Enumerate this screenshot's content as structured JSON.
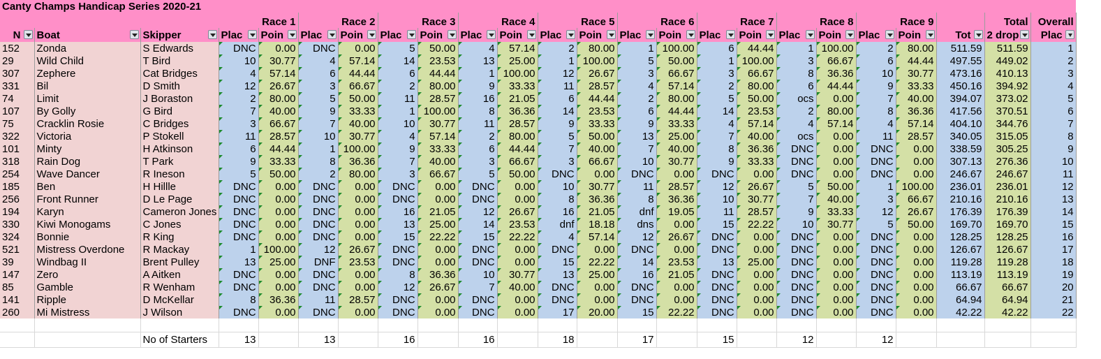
{
  "title": "Canty Champs Handicap Series 2020-21",
  "header": {
    "col_no": "N",
    "col_boat": "Boat",
    "col_skipper": "Skipper",
    "place_short": "Plac",
    "points_short": "Poin",
    "races": [
      "Race 1",
      "Race 2",
      "Race 3",
      "Race 4",
      "Race 5",
      "Race 6",
      "Race 7",
      "Race 8",
      "Race 9"
    ],
    "total_top": "Total",
    "total_label": "Tot",
    "total_drop": "2 drop",
    "overall_top": "Overall",
    "overall_label": "Plac"
  },
  "rows": [
    {
      "no": "152",
      "boat": "Zonda",
      "skipper": "S Edwards",
      "results": [
        [
          "DNC",
          "0.00"
        ],
        [
          "DNC",
          "0.00"
        ],
        [
          "5",
          "50.00"
        ],
        [
          "4",
          "57.14"
        ],
        [
          "2",
          "80.00"
        ],
        [
          "1",
          "100.00"
        ],
        [
          "6",
          "44.44"
        ],
        [
          "1",
          "100.00"
        ],
        [
          "2",
          "80.00"
        ]
      ],
      "total": "511.59",
      "total2": "511.59",
      "overall": "1"
    },
    {
      "no": "29",
      "boat": "Wild Child",
      "skipper": "T Bird",
      "results": [
        [
          "10",
          "30.77"
        ],
        [
          "4",
          "57.14"
        ],
        [
          "14",
          "23.53"
        ],
        [
          "13",
          "25.00"
        ],
        [
          "1",
          "100.00"
        ],
        [
          "5",
          "50.00"
        ],
        [
          "1",
          "100.00"
        ],
        [
          "3",
          "66.67"
        ],
        [
          "6",
          "44.44"
        ]
      ],
      "total": "497.55",
      "total2": "449.02",
      "overall": "2"
    },
    {
      "no": "307",
      "boat": "Zephere",
      "skipper": "Cat Bridges",
      "results": [
        [
          "4",
          "57.14"
        ],
        [
          "6",
          "44.44"
        ],
        [
          "6",
          "44.44"
        ],
        [
          "1",
          "100.00"
        ],
        [
          "12",
          "26.67"
        ],
        [
          "3",
          "66.67"
        ],
        [
          "3",
          "66.67"
        ],
        [
          "8",
          "36.36"
        ],
        [
          "10",
          "30.77"
        ]
      ],
      "total": "473.16",
      "total2": "410.13",
      "overall": "3"
    },
    {
      "no": "331",
      "boat": "Bil",
      "skipper": "D Smith",
      "results": [
        [
          "12",
          "26.67"
        ],
        [
          "3",
          "66.67"
        ],
        [
          "2",
          "80.00"
        ],
        [
          "9",
          "33.33"
        ],
        [
          "11",
          "28.57"
        ],
        [
          "4",
          "57.14"
        ],
        [
          "2",
          "80.00"
        ],
        [
          "6",
          "44.44"
        ],
        [
          "9",
          "33.33"
        ]
      ],
      "total": "450.16",
      "total2": "394.92",
      "overall": "4"
    },
    {
      "no": "74",
      "boat": "Limit",
      "skipper": "J Boraston",
      "results": [
        [
          "2",
          "80.00"
        ],
        [
          "5",
          "50.00"
        ],
        [
          "11",
          "28.57"
        ],
        [
          "16",
          "21.05"
        ],
        [
          "6",
          "44.44"
        ],
        [
          "2",
          "80.00"
        ],
        [
          "5",
          "50.00"
        ],
        [
          "ocs",
          "0.00"
        ],
        [
          "7",
          "40.00"
        ]
      ],
      "total": "394.07",
      "total2": "373.02",
      "overall": "5"
    },
    {
      "no": "107",
      "boat": "By Golly",
      "skipper": "G Bird",
      "results": [
        [
          "7",
          "40.00"
        ],
        [
          "9",
          "33.33"
        ],
        [
          "1",
          "100.00"
        ],
        [
          "8",
          "36.36"
        ],
        [
          "14",
          "23.53"
        ],
        [
          "6",
          "44.44"
        ],
        [
          "14",
          "23.53"
        ],
        [
          "2",
          "80.00"
        ],
        [
          "8",
          "36.36"
        ]
      ],
      "total": "417.56",
      "total2": "370.51",
      "overall": "6"
    },
    {
      "no": "75",
      "boat": "Cracklin Rosie",
      "skipper": "C Bridges",
      "results": [
        [
          "3",
          "66.67"
        ],
        [
          "7",
          "40.00"
        ],
        [
          "10",
          "30.77"
        ],
        [
          "11",
          "28.57"
        ],
        [
          "9",
          "33.33"
        ],
        [
          "9",
          "33.33"
        ],
        [
          "4",
          "57.14"
        ],
        [
          "4",
          "57.14"
        ],
        [
          "4",
          "57.14"
        ]
      ],
      "total": "404.10",
      "total2": "344.76",
      "overall": "7"
    },
    {
      "no": "322",
      "boat": "Victoria",
      "skipper": "P Stokell",
      "results": [
        [
          "11",
          "28.57"
        ],
        [
          "10",
          "30.77"
        ],
        [
          "4",
          "57.14"
        ],
        [
          "2",
          "80.00"
        ],
        [
          "5",
          "50.00"
        ],
        [
          "13",
          "25.00"
        ],
        [
          "7",
          "40.00"
        ],
        [
          "ocs",
          "0.00"
        ],
        [
          "11",
          "28.57"
        ]
      ],
      "total": "340.05",
      "total2": "315.05",
      "overall": "8"
    },
    {
      "no": "101",
      "boat": "Minty",
      "skipper": "H Atkinson",
      "results": [
        [
          "6",
          "44.44"
        ],
        [
          "1",
          "100.00"
        ],
        [
          "9",
          "33.33"
        ],
        [
          "6",
          "44.44"
        ],
        [
          "7",
          "40.00"
        ],
        [
          "7",
          "40.00"
        ],
        [
          "8",
          "36.36"
        ],
        [
          "DNC",
          "0.00"
        ],
        [
          "DNC",
          "0.00"
        ]
      ],
      "total": "338.59",
      "total2": "305.25",
      "overall": "9"
    },
    {
      "no": "318",
      "boat": "Rain Dog",
      "skipper": "T Park",
      "results": [
        [
          "9",
          "33.33"
        ],
        [
          "8",
          "36.36"
        ],
        [
          "7",
          "40.00"
        ],
        [
          "3",
          "66.67"
        ],
        [
          "3",
          "66.67"
        ],
        [
          "10",
          "30.77"
        ],
        [
          "9",
          "33.33"
        ],
        [
          "DNC",
          "0.00"
        ],
        [
          "DNC",
          "0.00"
        ]
      ],
      "total": "307.13",
      "total2": "276.36",
      "overall": "10"
    },
    {
      "no": "254",
      "boat": "Wave Dancer",
      "skipper": "R Ineson",
      "results": [
        [
          "5",
          "50.00"
        ],
        [
          "2",
          "80.00"
        ],
        [
          "3",
          "66.67"
        ],
        [
          "5",
          "50.00"
        ],
        [
          "DNC",
          "0.00"
        ],
        [
          "DNC",
          "0.00"
        ],
        [
          "DNC",
          "0.00"
        ],
        [
          "DNC",
          "0.00"
        ],
        [
          "DNC",
          "0.00"
        ]
      ],
      "total": "246.67",
      "total2": "246.67",
      "overall": "11"
    },
    {
      "no": "185",
      "boat": "Ben",
      "skipper": "H Hillle",
      "results": [
        [
          "DNC",
          "0.00"
        ],
        [
          "DNC",
          "0.00"
        ],
        [
          "DNC",
          "0.00"
        ],
        [
          "DNC",
          "0.00"
        ],
        [
          "10",
          "30.77"
        ],
        [
          "11",
          "28.57"
        ],
        [
          "12",
          "26.67"
        ],
        [
          "5",
          "50.00"
        ],
        [
          "1",
          "100.00"
        ]
      ],
      "total": "236.01",
      "total2": "236.01",
      "overall": "12"
    },
    {
      "no": "256",
      "boat": "Front Runner",
      "skipper": "D Le Page",
      "results": [
        [
          "DNC",
          "0.00"
        ],
        [
          "DNC",
          "0.00"
        ],
        [
          "DNC",
          "0.00"
        ],
        [
          "DNC",
          "0.00"
        ],
        [
          "8",
          "36.36"
        ],
        [
          "8",
          "36.36"
        ],
        [
          "10",
          "30.77"
        ],
        [
          "7",
          "40.00"
        ],
        [
          "3",
          "66.67"
        ]
      ],
      "total": "210.16",
      "total2": "210.16",
      "overall": "13"
    },
    {
      "no": "194",
      "boat": "Karyn",
      "skipper": "Cameron Jones",
      "results": [
        [
          "DNC",
          "0.00"
        ],
        [
          "DNC",
          "0.00"
        ],
        [
          "16",
          "21.05"
        ],
        [
          "12",
          "26.67"
        ],
        [
          "16",
          "21.05"
        ],
        [
          "dnf",
          "19.05"
        ],
        [
          "11",
          "28.57"
        ],
        [
          "9",
          "33.33"
        ],
        [
          "12",
          "26.67"
        ]
      ],
      "total": "176.39",
      "total2": "176.39",
      "overall": "14"
    },
    {
      "no": "330",
      "boat": "Kiwi Monogams",
      "skipper": "C Jones",
      "results": [
        [
          "DNC",
          "0.00"
        ],
        [
          "DNC",
          "0.00"
        ],
        [
          "13",
          "25.00"
        ],
        [
          "14",
          "23.53"
        ],
        [
          "dnf",
          "18.18"
        ],
        [
          "dns",
          "0.00"
        ],
        [
          "15",
          "22.22"
        ],
        [
          "10",
          "30.77"
        ],
        [
          "5",
          "50.00"
        ]
      ],
      "total": "169.70",
      "total2": "169.70",
      "overall": "15"
    },
    {
      "no": "324",
      "boat": "Bonnie",
      "skipper": "R King",
      "results": [
        [
          "DNC",
          "0.00"
        ],
        [
          "DNC",
          "0.00"
        ],
        [
          "15",
          "22.22"
        ],
        [
          "15",
          "22.22"
        ],
        [
          "4",
          "57.14"
        ],
        [
          "12",
          "26.67"
        ],
        [
          "DNC",
          "0.00"
        ],
        [
          "DNC",
          "0.00"
        ],
        [
          "DNC",
          "0.00"
        ]
      ],
      "total": "128.25",
      "total2": "128.25",
      "overall": "16"
    },
    {
      "no": "521",
      "boat": "Mistress Overdone",
      "skipper": "R Mackay",
      "results": [
        [
          "1",
          "100.00"
        ],
        [
          "12",
          "26.67"
        ],
        [
          "DNC",
          "0.00"
        ],
        [
          "DNC",
          "0.00"
        ],
        [
          "DNC",
          "0.00"
        ],
        [
          "DNC",
          "0.00"
        ],
        [
          "DNC",
          "0.00"
        ],
        [
          "DNC",
          "0.00"
        ],
        [
          "DNC",
          "0.00"
        ]
      ],
      "total": "126.67",
      "total2": "126.67",
      "overall": "17"
    },
    {
      "no": "39",
      "boat": "Windbag II",
      "skipper": "Brent Pulley",
      "results": [
        [
          "13",
          "25.00"
        ],
        [
          "DNF",
          "23.53"
        ],
        [
          "DNC",
          "0.00"
        ],
        [
          "DNC",
          "0.00"
        ],
        [
          "15",
          "22.22"
        ],
        [
          "14",
          "23.53"
        ],
        [
          "13",
          "25.00"
        ],
        [
          "DNC",
          "0.00"
        ],
        [
          "DNC",
          "0.00"
        ]
      ],
      "total": "119.28",
      "total2": "119.28",
      "overall": "18"
    },
    {
      "no": "147",
      "boat": "Zero",
      "skipper": "A Aitken",
      "results": [
        [
          "DNC",
          "0.00"
        ],
        [
          "DNC",
          "0.00"
        ],
        [
          "8",
          "36.36"
        ],
        [
          "10",
          "30.77"
        ],
        [
          "13",
          "25.00"
        ],
        [
          "16",
          "21.05"
        ],
        [
          "DNC",
          "0.00"
        ],
        [
          "DNC",
          "0.00"
        ],
        [
          "DNC",
          "0.00"
        ]
      ],
      "total": "113.19",
      "total2": "113.19",
      "overall": "19"
    },
    {
      "no": "85",
      "boat": "Gamble",
      "skipper": "R Wenham",
      "results": [
        [
          "DNC",
          "0.00"
        ],
        [
          "DNC",
          "0.00"
        ],
        [
          "12",
          "26.67"
        ],
        [
          "7",
          "40.00"
        ],
        [
          "DNC",
          "0.00"
        ],
        [
          "DNC",
          "0.00"
        ],
        [
          "DNC",
          "0.00"
        ],
        [
          "DNC",
          "0.00"
        ],
        [
          "DNC",
          "0.00"
        ]
      ],
      "total": "66.67",
      "total2": "66.67",
      "overall": "20"
    },
    {
      "no": "141",
      "boat": "Ripple",
      "skipper": "D McKellar",
      "results": [
        [
          "8",
          "36.36"
        ],
        [
          "11",
          "28.57"
        ],
        [
          "DNC",
          "0.00"
        ],
        [
          "DNC",
          "0.00"
        ],
        [
          "DNC",
          "0.00"
        ],
        [
          "DNC",
          "0.00"
        ],
        [
          "DNC",
          "0.00"
        ],
        [
          "DNC",
          "0.00"
        ],
        [
          "DNC",
          "0.00"
        ]
      ],
      "total": "64.94",
      "total2": "64.94",
      "overall": "21"
    },
    {
      "no": "260",
      "boat": "Mi Mistress",
      "skipper": "J Wilson",
      "results": [
        [
          "DNC",
          "0.00"
        ],
        [
          "DNC",
          "0.00"
        ],
        [
          "DNC",
          "0.00"
        ],
        [
          "DNC",
          "0.00"
        ],
        [
          "17",
          "20.00"
        ],
        [
          "15",
          "22.22"
        ],
        [
          "DNC",
          "0.00"
        ],
        [
          "DNC",
          "0.00"
        ],
        [
          "DNC",
          "0.00"
        ]
      ],
      "total": "42.22",
      "total2": "42.22",
      "overall": "22"
    }
  ],
  "footer": {
    "label": "No of Starters",
    "starters": [
      "13",
      "13",
      "16",
      "16",
      "18",
      "17",
      "15",
      "12",
      "12"
    ]
  },
  "colors": {
    "header_pink": "#ff8fc8",
    "name_cols": "#f1d3d3",
    "place_blue": "#bdd2ec",
    "points_green": "#d4e0a6",
    "comment_marker": "#1c8a2b"
  }
}
